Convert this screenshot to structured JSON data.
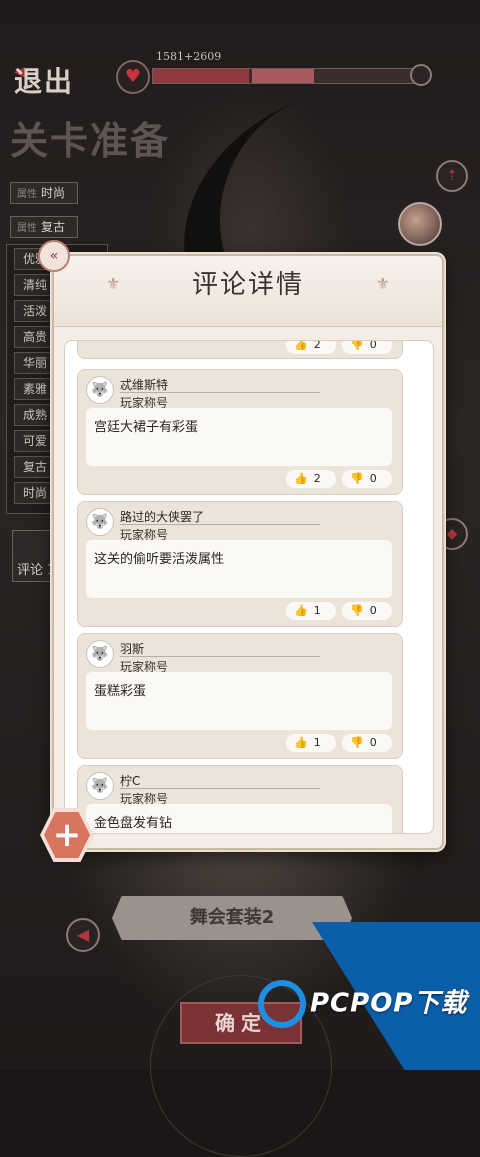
{
  "header": {
    "exit_label": "退出",
    "hp_text": "1581+2609",
    "hp_fill_fraction": 0.37,
    "hp_fill2_fraction": 0.61,
    "stage_title": "关卡准备"
  },
  "tags": [
    {
      "prefix": "属性",
      "label": "时尚"
    },
    {
      "prefix": "属性",
      "label": "复古"
    }
  ],
  "attributes": [
    "优雅",
    "清纯",
    "活泼",
    "高贵",
    "华丽",
    "素雅",
    "成熟",
    "可爱",
    "复古",
    "时尚"
  ],
  "review_tab_label": "评论 1",
  "suit_name": "舞会套装2",
  "confirm_label": "确定",
  "modal": {
    "title": "评论详情",
    "comments": [
      {
        "name": "",
        "title": "",
        "body": "",
        "likes": "2",
        "dislikes": "0",
        "partial": true
      },
      {
        "name": "忒维斯特",
        "title": "玩家称号",
        "body": "宫廷大裙子有彩蛋",
        "likes": "2",
        "dislikes": "0"
      },
      {
        "name": "路过的大侠罢了",
        "title": "玩家称号",
        "body": "这关的偷听要活泼属性",
        "likes": "1",
        "dislikes": "0"
      },
      {
        "name": "羽斯",
        "title": "玩家称号",
        "body": "蛋糕彩蛋",
        "likes": "1",
        "dislikes": "0"
      },
      {
        "name": "柠C",
        "title": "玩家称号",
        "body": "金色盘发有钻",
        "likes": "",
        "dislikes": ""
      }
    ]
  },
  "watermark": "PCPOP下载",
  "colors": {
    "accent": "#d8745f",
    "hp": "#8e3a40",
    "watermark_bg": "#0b5ea8"
  }
}
